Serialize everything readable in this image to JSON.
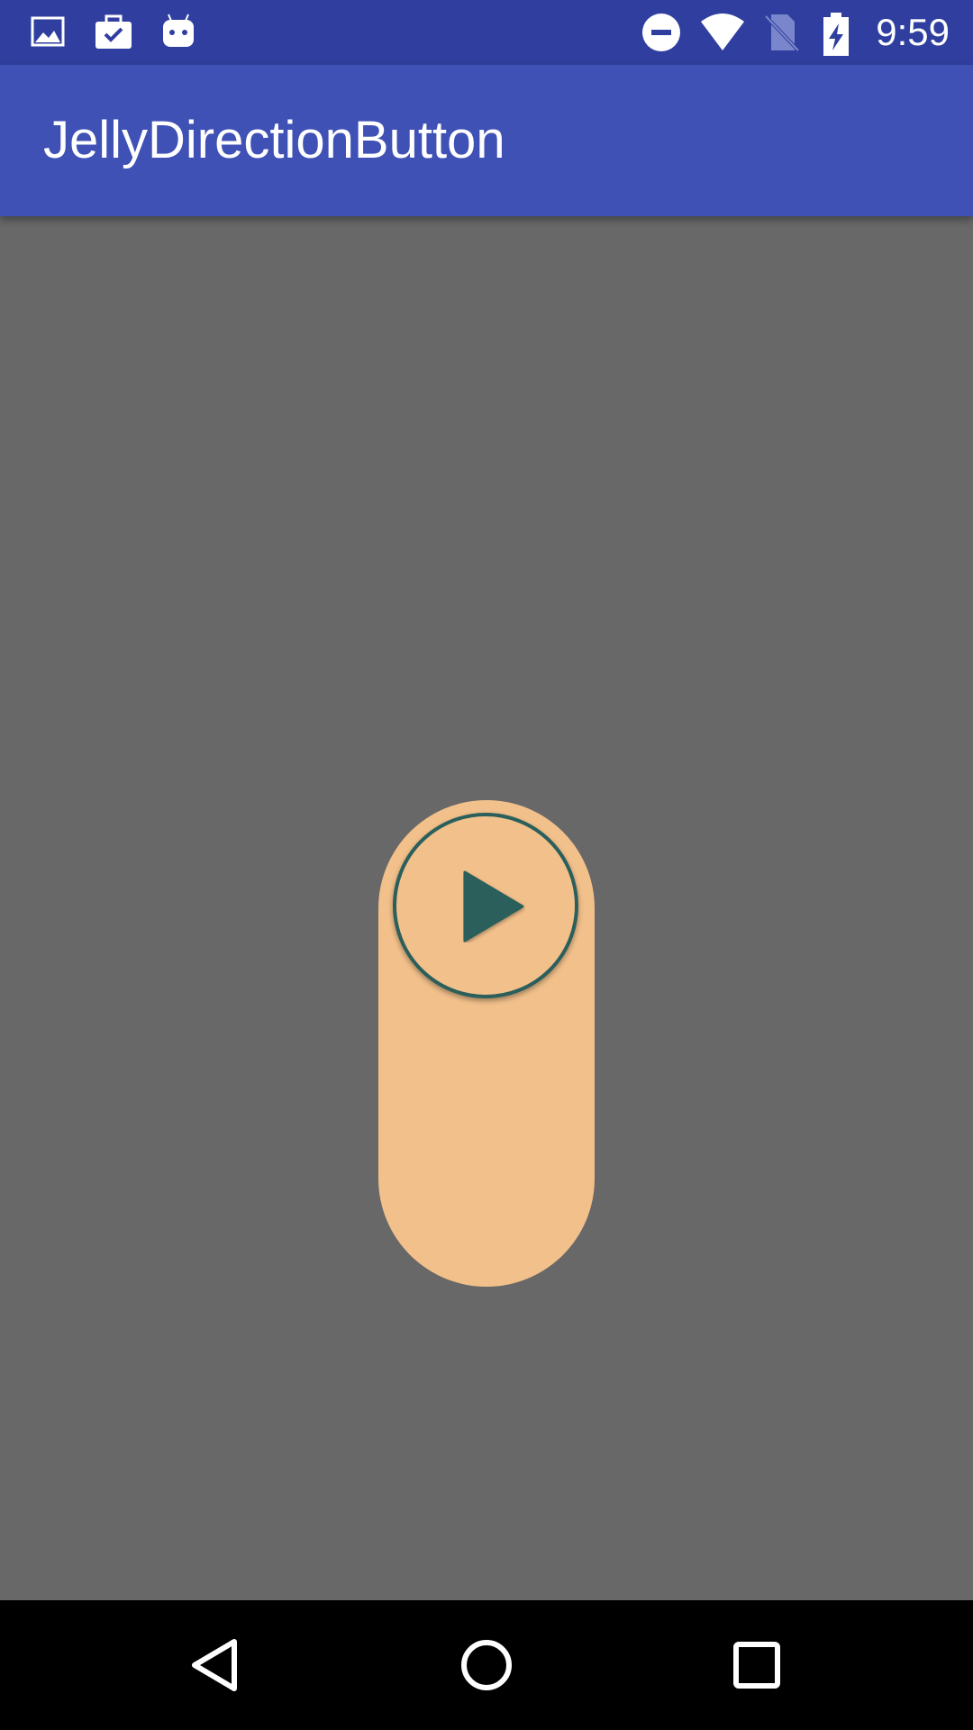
{
  "status_bar": {
    "time": "9:59",
    "background": "#303f9f",
    "left_icons": [
      "image-icon",
      "briefcase-check-icon",
      "android-icon"
    ],
    "right_icons": [
      "do-not-disturb-icon",
      "wifi-icon",
      "no-sim-icon",
      "battery-charging-icon"
    ]
  },
  "app_bar": {
    "title": "JellyDirectionButton",
    "background": "#3f51b5"
  },
  "content": {
    "background": "#686868",
    "jelly_button": {
      "track_color": "#f2c08b",
      "knob_border_color": "#2b5f5c",
      "icon": "play-icon",
      "icon_color": "#2b5f5c"
    }
  },
  "nav_bar": {
    "buttons": [
      "back-icon",
      "home-icon",
      "recents-icon"
    ],
    "background": "#000000"
  }
}
